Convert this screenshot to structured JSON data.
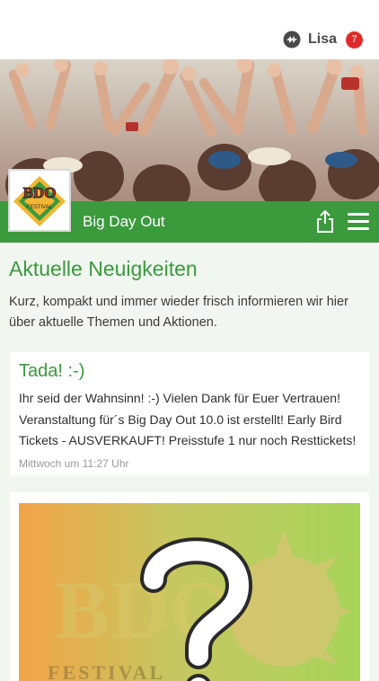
{
  "header": {
    "app_icon": "refresh-logo-icon",
    "user_name": "Lisa",
    "notification_count": "7",
    "badge_color": "#e02b2b"
  },
  "brand": {
    "name": "Big Day Out",
    "logo_text": "BDO",
    "logo_subtext": "FESTIVAL",
    "accent_color": "#3a9a3c",
    "share_icon": "share-icon",
    "menu_icon": "hamburger-menu-icon"
  },
  "news": {
    "title": "Aktuelle Neuigkeiten",
    "description": "Kurz, kompakt und immer wieder frisch informieren wir hier über aktuelle Themen und Aktionen.",
    "posts": [
      {
        "title": "Tada! :-)",
        "text": "Ihr seid der Wahnsinn! :-) Vielen Dank für Euer Vertrauen! Veranstaltung für´s Big Day Out 10.0 ist erstellt! Early Bird Tickets - AUSVERKAUFT! Preisstufe 1 nur noch Resttickets!",
        "time": "Mittwoch um 11:27 Uhr"
      },
      {
        "image_text": "BDO",
        "image_subtext": "FESTIVAL",
        "image_icon": "question-mark-icon"
      }
    ]
  }
}
